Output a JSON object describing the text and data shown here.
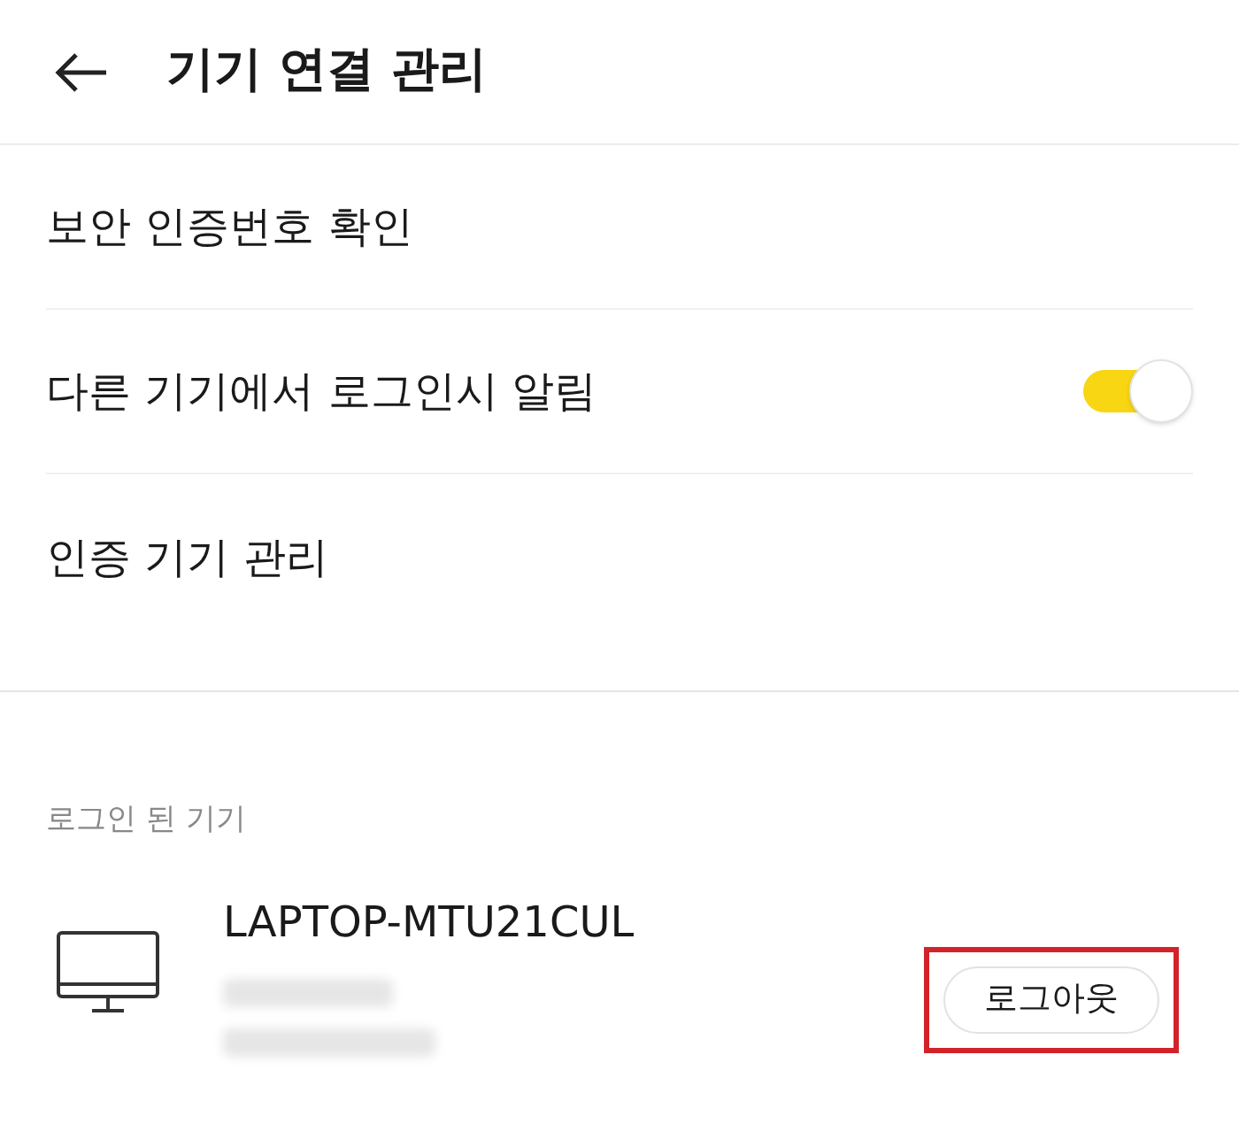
{
  "header": {
    "title": "기기 연결 관리"
  },
  "menu_items": [
    {
      "kind": "link",
      "label": "보안 인증번호 확인"
    },
    {
      "kind": "toggle",
      "label": "다른 기기에서 로그인시 알림",
      "on": true
    },
    {
      "kind": "link",
      "label": "인증 기기 관리"
    }
  ],
  "logged_in_section": {
    "title": "로그인 된 기기",
    "devices": [
      {
        "name": "LAPTOP-MTU21CUL",
        "button": "로그아웃",
        "highlighted": true
      }
    ]
  }
}
